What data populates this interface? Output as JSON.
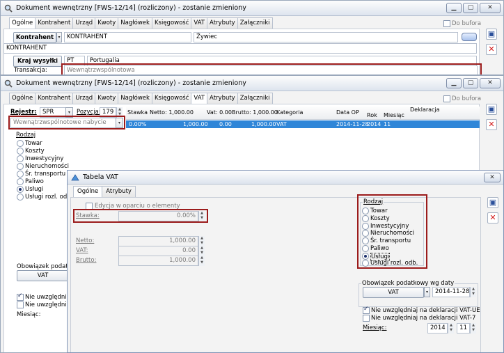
{
  "win1": {
    "title": "Dokument wewnętrzny [FWS-12/14] (rozliczony) - zostanie zmieniony",
    "tabs": [
      "Ogólne",
      "Kontrahent",
      "Urząd",
      "Kwoty",
      "Nagłówek",
      "Księgowość",
      "VAT",
      "Atrybuty",
      "Załączniki"
    ],
    "do_bufora": "Do bufora",
    "kontrahent_btn": "Kontrahent",
    "kontrahent_code": "KONTRAHENT",
    "kontrahent_city": "Żywiec",
    "kontrahent_name": "KONTRAHENT",
    "kraj_btn": "Kraj wysyłki",
    "kraj_code": "PT",
    "kraj_name": "Portugalia",
    "transakcja_label": "Transakcja:",
    "transakcja_value": "Wewnątrzwspólnotowa"
  },
  "win2": {
    "title": "Dokument wewnętrzny [FWS-12/14] (rozliczony) - zostanie zmieniony",
    "tabs": [
      "Ogólne",
      "Kontrahent",
      "Urząd",
      "Kwoty",
      "Nagłówek",
      "Księgowość",
      "VAT",
      "Atrybuty",
      "Załączniki"
    ],
    "do_bufora": "Do bufora",
    "rejestr_label": "Rejestr:",
    "rejestr_value": "SPR",
    "pozycja_label": "Pozycja:",
    "pozycja_value": "179",
    "nabycie_value": "Wewnątrzwspólnotowe nabycie",
    "rodzaj_label": "Rodzaj",
    "rodzaj_options": [
      "Towar",
      "Koszty",
      "Inwestycyjny",
      "Nieruchomości",
      "Śr. transportu",
      "Paliwo",
      "Usługi",
      "Usługi rozl. odb."
    ],
    "rodzaj_selected": "Usługi",
    "grid_headers": {
      "stawka": "Stawka",
      "netto": "Netto: 1,000.00",
      "vat": "Vat: 0.00",
      "brutto": "Brutto: 1,000.00",
      "kategoria": "Kategoria",
      "data_op": "Data OP",
      "deklaracja": "Deklaracja",
      "rok": "Rok",
      "miesiac": "Miesiąc"
    },
    "grid_row": {
      "stawka": "0.00%",
      "netto": "1,000.00",
      "vat": "0.00",
      "brutto": "1,000.00",
      "kategoria": "VAT",
      "data_op": "2014-11-28",
      "rok": "2014",
      "miesiac": "11"
    },
    "obowiazek_label": "Obowiązek podatkow",
    "vat_btn": "VAT",
    "nie_uwzgl_1": "Nie uwzględniaj na",
    "nie_uwzgl_2": "Nie uwzględniaj na",
    "miesiac_label": "Miesiąc:"
  },
  "win3": {
    "title": "Tabela VAT",
    "tabs": [
      "Ogólne",
      "Atrybuty"
    ],
    "edycja_label": "Edycja w oparciu o elementy",
    "stawka_label": "Stawka:",
    "stawka_value": "0.00%",
    "netto_label": "Netto:",
    "netto_value": "1,000.00",
    "vat_label": "VAT:",
    "vat_value": "0.00",
    "brutto_label": "Brutto:",
    "brutto_value": "1,000.00",
    "rodzaj_label": "Rodzaj",
    "rodzaj_options": [
      "Towar",
      "Koszty",
      "Inwestycyjny",
      "Nieruchomości",
      "Śr. transportu",
      "Paliwo",
      "Usługi",
      "Usługi rozl. odb."
    ],
    "rodzaj_selected": "Usługi",
    "obowiazek_label": "Obowiązek podatkowy wg daty",
    "vat_btn": "VAT",
    "obowiazek_date": "2014-11-28",
    "nie_uwzgl_ue": "Nie uwzględniaj na deklaracji VAT-UE",
    "nie_uwzgl_ue_checked": true,
    "nie_uwzgl_7": "Nie uwzględniaj na deklaracji VAT-7",
    "miesiac_label": "Miesiąc:",
    "miesiac_year": "2014",
    "miesiac_month": "11"
  }
}
